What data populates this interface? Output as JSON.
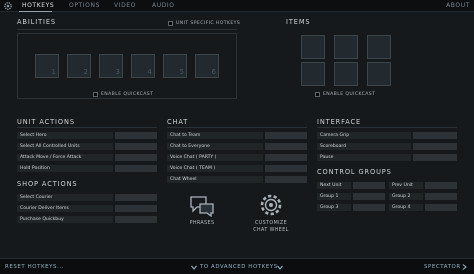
{
  "colors": {
    "background": "#15191c",
    "topbar": "#0c0e10",
    "link": "#8fb2c4",
    "slot": "#222a2f"
  },
  "tabs": [
    {
      "label": "HOTKEYS",
      "active": true
    },
    {
      "label": "OPTIONS",
      "active": false
    },
    {
      "label": "VIDEO",
      "active": false
    },
    {
      "label": "AUDIO",
      "active": false
    }
  ],
  "about_label": "ABOUT",
  "abilities": {
    "title": "ABILITIES",
    "unit_specific_label": "UNIT SPECIFIC HOTKEYS",
    "slots": [
      "1",
      "2",
      "3",
      "4",
      "5",
      "6"
    ],
    "quickcast_label": "ENABLE QUICKCAST"
  },
  "items": {
    "title": "ITEMS",
    "quickcast_label": "ENABLE QUICKCAST"
  },
  "unit_actions": {
    "title": "UNIT ACTIONS",
    "rows": [
      "Select Hero",
      "Select All Controlled Units",
      "Attack Move / Force Attack",
      "Hold Position"
    ]
  },
  "shop_actions": {
    "title": "SHOP ACTIONS",
    "rows": [
      "Select Courier",
      "Courier Deliver Items",
      "Purchase Quickbuy"
    ]
  },
  "chat": {
    "title": "CHAT",
    "rows": [
      "Chat to Team",
      "Chat to Everyone",
      "Voice Chat ( PARTY )",
      "Voice Chat ( TEAM )",
      "Chat Wheel"
    ],
    "phrases_label": "PHRASES",
    "customize_label_line1": "CUSTOMIZE",
    "customize_label_line2": "CHAT WHEEL"
  },
  "interface": {
    "title": "INTERFACE",
    "rows": [
      "Camera Grip",
      "Scoreboard",
      "Pause"
    ]
  },
  "control_groups": {
    "title": "CONTROL GROUPS",
    "rows_left": [
      "Next Unit",
      "Group 1",
      "Group 3"
    ],
    "rows_right": [
      "Prev Unit",
      "Group 2",
      "Group 4"
    ]
  },
  "bottom": {
    "reset_label": "RESET HOTKEYS...",
    "advanced_label": "TO ADVANCED HOTKEYS",
    "spectator_label": "SPECTATOR"
  },
  "icons": [
    "gear-icon",
    "chat-bubbles-icon",
    "gear-wheel-icon",
    "chevron-down-icon",
    "chevron-right-icon"
  ]
}
